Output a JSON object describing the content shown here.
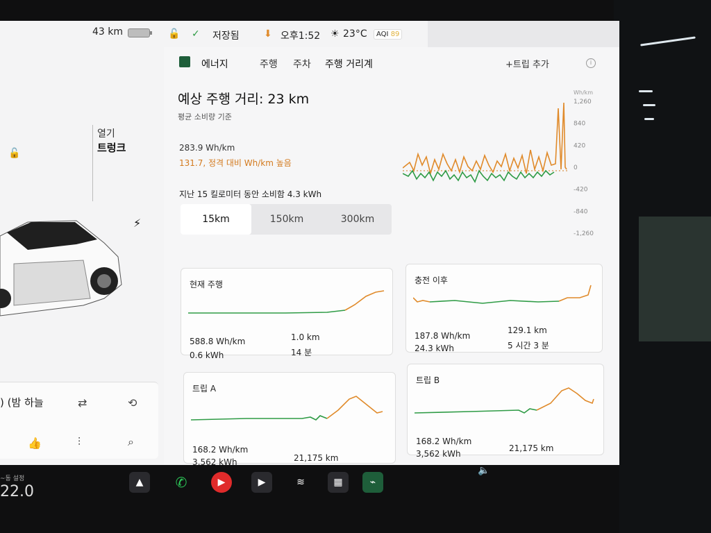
{
  "left": {
    "range": "43 km",
    "open_label": "열기",
    "trunk_label": "트렁크",
    "media_title": ") (밤 하늘"
  },
  "status": {
    "saved": "저장됨",
    "time": "오후1:52",
    "temp": "23°C",
    "aqi_label": "AQI",
    "aqi_value": "89"
  },
  "tabs": [
    {
      "label": "에너지"
    },
    {
      "label": "주행"
    },
    {
      "label": "주차"
    },
    {
      "label": "주행 거리계"
    }
  ],
  "trip_add": "+트립 추가",
  "energy": {
    "range_title": "예상 주행 거리: 23 km",
    "range_sub": "평균 소비량 기준",
    "avg": "283.9 Wh/km",
    "diff": "131.7, 정격 대비 Wh/km 높음",
    "last_line": "지난 15 킬로미터 동안 소비함 4.3 kWh",
    "segments": [
      "15km",
      "150km",
      "300km"
    ],
    "selected_segment": "15km"
  },
  "chart_data": {
    "type": "line",
    "ylabel": "Wh/km",
    "yticks": [
      1260,
      840,
      420,
      0,
      -420,
      -840,
      -1260
    ],
    "ylim": [
      -1260,
      1260
    ],
    "series": [],
    "colors": {
      "above": "#e08a2a",
      "below": "#2e9b45"
    }
  },
  "cards": {
    "current": {
      "title": "현재 주행",
      "whkm": "588.8 Wh/km",
      "kwh": "0.6 kWh",
      "dist": "1.0 km",
      "time": "14 분"
    },
    "since_charge": {
      "title": "충전 이후",
      "whkm": "187.8 Wh/km",
      "kwh": "24.3 kWh",
      "dist": "129.1 km",
      "time": "5 시간 3 분"
    },
    "trip_a": {
      "title": "트립 A",
      "whkm": "168.2 Wh/km",
      "kwh": "3,562 kWh",
      "dist": "21,175 km"
    },
    "trip_b": {
      "title": "트립 B",
      "whkm": "168.2 Wh/km",
      "kwh": "3,562 kWh",
      "dist": "21,175 km"
    }
  },
  "dock": {
    "temp_label": "~동 설정",
    "temp": "22.0"
  }
}
